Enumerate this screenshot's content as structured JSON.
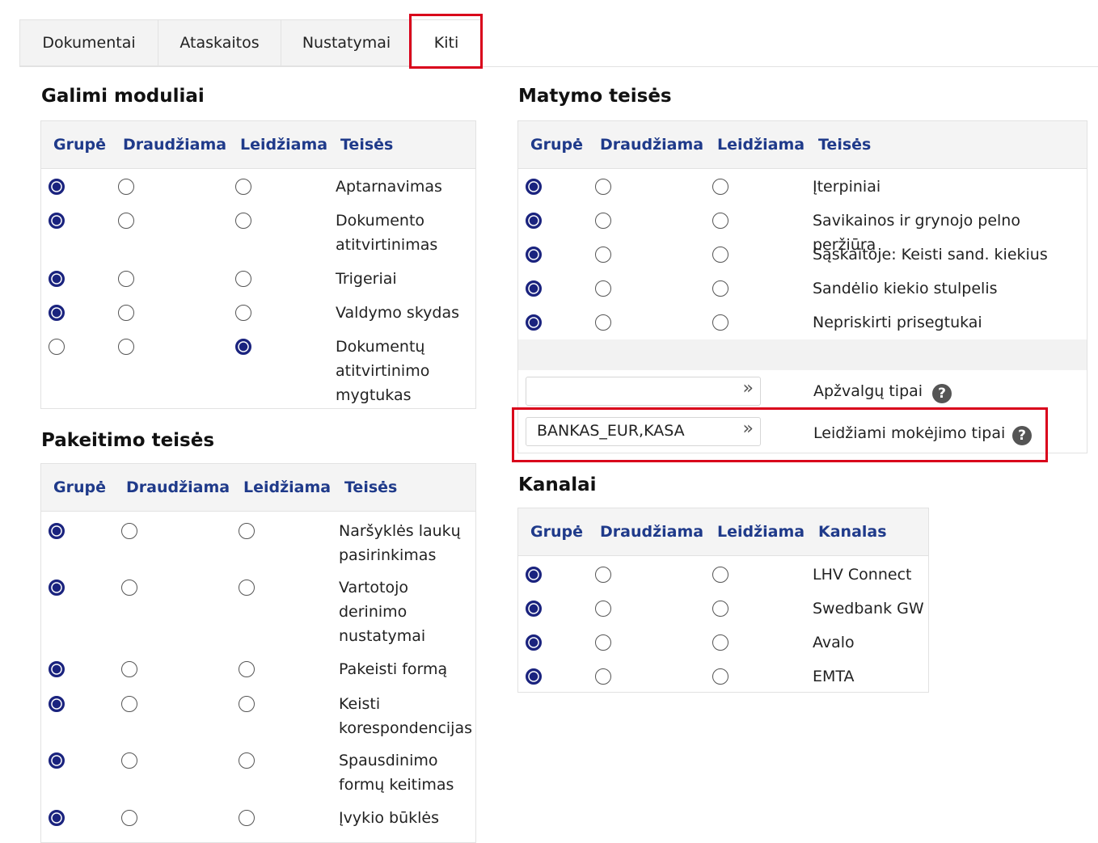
{
  "tabs": [
    "Dokumentai",
    "Ataskaitos",
    "Nustatymai",
    "Kiti"
  ],
  "galimi": {
    "title": "Galimi moduliai",
    "headers": [
      "Grupė",
      "Draudžiama",
      "Leidžiama",
      "Teisės"
    ],
    "rows": [
      {
        "label": "Aptarnavimas",
        "sel": 0
      },
      {
        "label": "Dokumento atitvirtinimas",
        "sel": 0
      },
      {
        "label": "Trigeriai",
        "sel": 0
      },
      {
        "label": "Valdymo skydas",
        "sel": 0
      },
      {
        "label": "Dokumentų atitvirtinimo mygtukas",
        "sel": 2
      }
    ]
  },
  "pakeitimo": {
    "title": "Pakeitimo teisės",
    "headers": [
      "Grupė",
      "Draudžiama",
      "Leidžiama",
      "Teisės"
    ],
    "rows": [
      {
        "label": "Naršyklės laukų pasirinkimas",
        "sel": 0
      },
      {
        "label": "Vartotojo derinimo nustatymai",
        "sel": 0
      },
      {
        "label": "Pakeisti formą",
        "sel": 0
      },
      {
        "label": "Keisti korespondencijas",
        "sel": 0
      },
      {
        "label": "Spausdinimo formų keitimas",
        "sel": 0
      },
      {
        "label": "Įvykio būklės",
        "sel": 0
      }
    ]
  },
  "matymo": {
    "title": "Matymo teisės",
    "headers": [
      "Grupė",
      "Draudžiama",
      "Leidžiama",
      "Teisės"
    ],
    "rows": [
      {
        "label": "Įterpiniai",
        "sel": 0
      },
      {
        "label": "Savikainos ir grynojo pelno peržiūra",
        "sel": 0
      },
      {
        "label": "Sąskaitoje: Keisti sand. kiekius",
        "sel": 0
      },
      {
        "label": "Sandėlio kiekio stulpelis",
        "sel": 0
      },
      {
        "label": "Nepriskirti prisegtukai",
        "sel": 0
      }
    ],
    "apzvalgu": {
      "value": "",
      "label": "Apžvalgų tipai",
      "arrow": "»",
      "help": "?"
    },
    "mokejimo": {
      "value": "BANKAS_EUR,KASA",
      "label": "Leidžiami mokėjimo tipai",
      "arrow": "»",
      "help": "?"
    }
  },
  "kanalai": {
    "title": "Kanalai",
    "headers": [
      "Grupė",
      "Draudžiama",
      "Leidžiama",
      "Kanalas"
    ],
    "rows": [
      {
        "label": "LHV Connect",
        "sel": 0
      },
      {
        "label": "Swedbank GW",
        "sel": 0
      },
      {
        "label": "Avalo",
        "sel": 0
      },
      {
        "label": "EMTA",
        "sel": 0
      }
    ]
  },
  "colors": {
    "accent": "#1a237e",
    "header_text": "#1f3a8a",
    "highlight": "#d9001b"
  }
}
